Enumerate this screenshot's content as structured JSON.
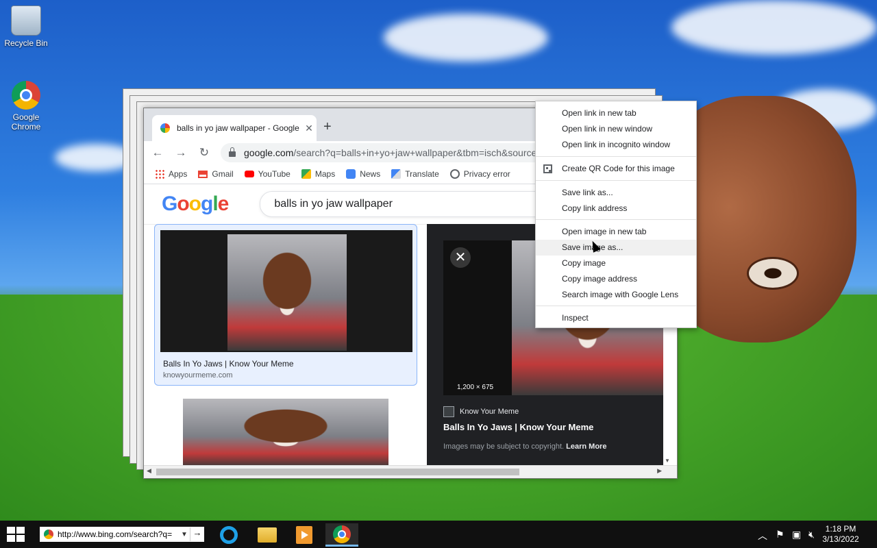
{
  "desktop": {
    "icons": [
      {
        "label": "Recycle Bin"
      },
      {
        "label": "Google Chrome"
      }
    ]
  },
  "browser": {
    "tab_title": "balls in yo jaw wallpaper - Google",
    "address": {
      "host": "google.com",
      "path": "/search?q=balls+in+yo+jaw+wallpaper&tbm=isch&source"
    },
    "bookmarks": [
      {
        "label": "Apps",
        "icon": "apps-icon"
      },
      {
        "label": "Gmail",
        "icon": "gmail-icon"
      },
      {
        "label": "YouTube",
        "icon": "youtube-icon"
      },
      {
        "label": "Maps",
        "icon": "maps-icon"
      },
      {
        "label": "News",
        "icon": "news-icon"
      },
      {
        "label": "Translate",
        "icon": "translate-icon"
      },
      {
        "label": "Privacy error",
        "icon": "privacy-icon"
      }
    ],
    "google": {
      "logo": [
        "G",
        "o",
        "o",
        "g",
        "l",
        "e"
      ],
      "query": "balls in yo jaw wallpaper"
    },
    "result": {
      "title": "Balls In Yo Jaws | Know Your Meme",
      "domain": "knowyourmeme.com"
    },
    "preview": {
      "dimensions": "1,200 × 675",
      "source": "Know Your Meme",
      "title": "Balls In Yo Jaws | Know Your Meme",
      "copyright": "Images may be subject to copyright.",
      "learn_more": "Learn More"
    }
  },
  "context_menu": {
    "items": [
      "Open link in new tab",
      "Open link in new window",
      "Open link in incognito window",
      "Create QR Code for this image",
      "Save link as...",
      "Copy link address",
      "Open image in new tab",
      "Save image as...",
      "Copy image",
      "Copy image address",
      "Search image with Google Lens",
      "Inspect"
    ],
    "hovered": "Save image as..."
  },
  "taskbar": {
    "address": "http://www.bing.com/search?q=",
    "time": "1:18 PM",
    "date": "3/13/2022"
  }
}
